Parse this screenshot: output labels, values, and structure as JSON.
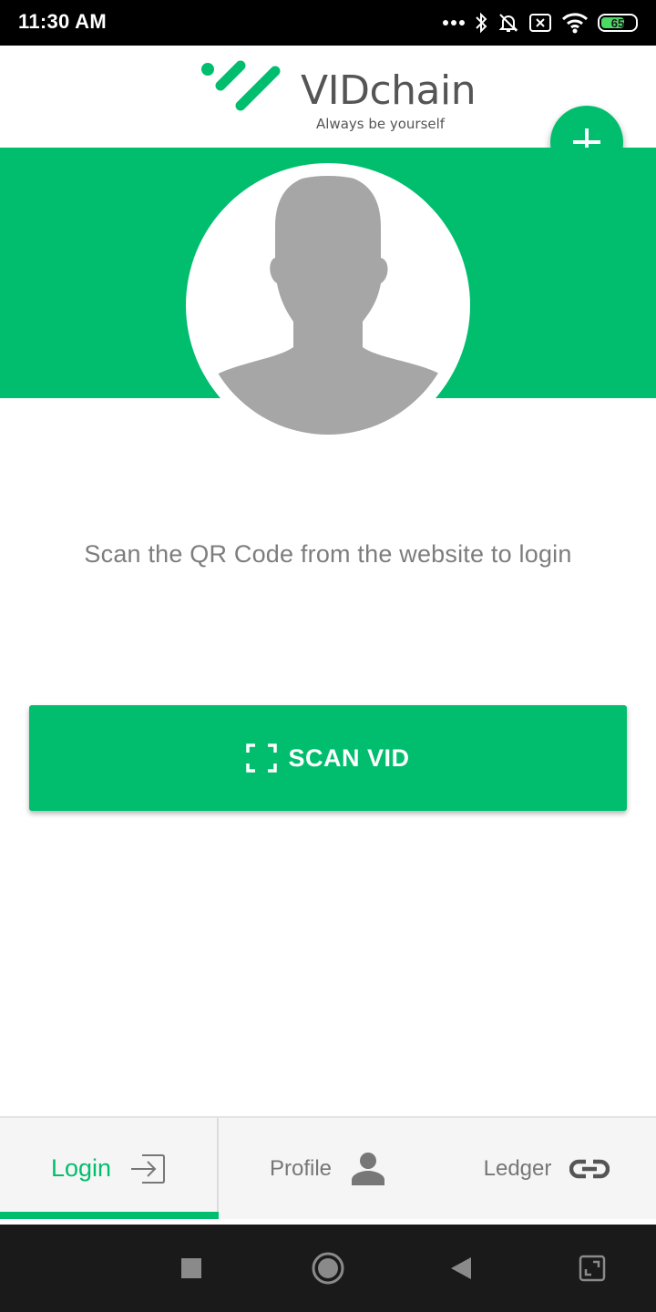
{
  "status_bar": {
    "time": "11:30 AM",
    "battery_level": "65",
    "icons": [
      "more-dots-icon",
      "bluetooth-icon",
      "bell-off-icon",
      "sim-off-icon",
      "wifi-icon",
      "battery-icon"
    ]
  },
  "header": {
    "logo_text": "VIDchain",
    "tagline": "Always be yourself",
    "add_icon": "plus-icon"
  },
  "colors": {
    "accent": "#00be6e",
    "text_muted": "#7d7d7d",
    "avatar_gray": "#a6a6a6"
  },
  "main": {
    "instruction": "Scan the QR Code from the website to login",
    "scan_button": {
      "label": "SCAN VID",
      "icon": "scan-frame-icon"
    }
  },
  "bottom_nav": {
    "tabs": [
      {
        "label": "Login",
        "icon": "login-arrow-icon",
        "active": true
      },
      {
        "label": "Profile",
        "icon": "person-icon",
        "active": false
      },
      {
        "label": "Ledger",
        "icon": "link-icon",
        "active": false
      }
    ]
  },
  "system_nav": {
    "buttons": [
      "recents-square-icon",
      "home-circle-icon",
      "back-triangle-icon",
      "screenshot-frame-icon"
    ]
  }
}
